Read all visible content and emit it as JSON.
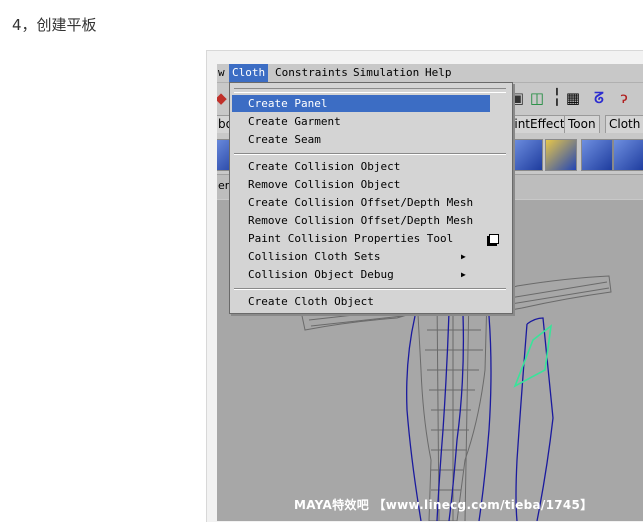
{
  "caption": "4，创建平板",
  "menubar": {
    "items": [
      "w",
      "Cloth",
      "Constraints",
      "Simulation",
      "Help"
    ],
    "active": "Cloth"
  },
  "shelf": {
    "tabs": [
      "bo",
      "aintEffects",
      "Toon",
      "Cloth"
    ]
  },
  "under_strip": {
    "label": "er"
  },
  "dropdown": {
    "items": [
      "Create Panel",
      "Create Garment",
      "Create Seam",
      "Create Collision Object",
      "Remove Collision Object",
      "Create Collision Offset/Depth Mesh",
      "Remove Collision Offset/Depth Mesh",
      "Paint Collision Properties Tool",
      "Collision Cloth Sets",
      "Collision Object Debug",
      "Create Cloth Object"
    ],
    "selected_index": 0
  },
  "watermark": "MAYA特效吧 【www.linecg.com/tieba/1745】",
  "colors": {
    "selection": "#3c6dc4",
    "menu_bg": "#d4d4d4",
    "viewport_bg": "#a7a7a7",
    "curve_blue": "#1a1a9e",
    "panel_green": "#39e39a"
  },
  "icons": [
    "keyframe-icon",
    "select-icon",
    "grid-icon",
    "curve-icon",
    "ribbon-icon"
  ]
}
